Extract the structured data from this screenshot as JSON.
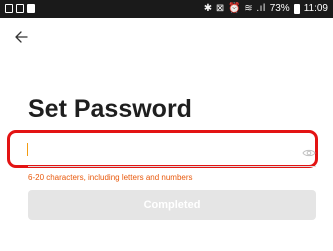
{
  "status_bar": {
    "time": "11:09",
    "battery_percent": "73%",
    "icons": [
      "mail-icon",
      "image-icon",
      "app-icon",
      "bluetooth-icon",
      "mute-icon",
      "alarm-icon",
      "wifi-icon",
      "signal-icon",
      "battery-icon"
    ]
  },
  "nav": {
    "back_icon": "arrow-left-icon"
  },
  "title": "Set Password",
  "password_field": {
    "value": "",
    "placeholder": "",
    "visibility_icon": "eye-icon"
  },
  "hint": "6-20 characters, including letters and numbers",
  "completed_button": {
    "label": "Completed",
    "enabled": false
  },
  "colors": {
    "status_bar_bg": "#1a1a1a",
    "highlight_border": "#e31313",
    "hint_text": "#e8590c",
    "caret": "#f39c12",
    "button_disabled_bg": "#e5e5e5"
  }
}
